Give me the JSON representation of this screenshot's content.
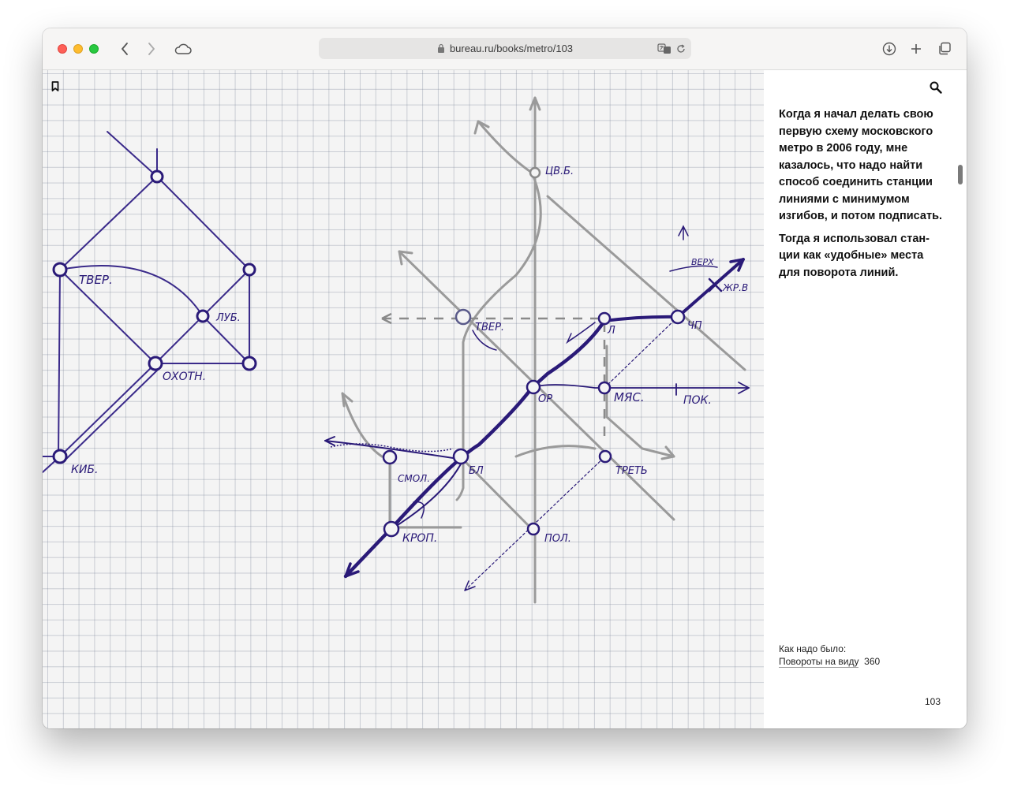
{
  "browser": {
    "url": "bureau.ru/books/metro/103",
    "icons": [
      "back-icon",
      "forward-icon",
      "cloud-icon",
      "lock-icon",
      "translate-icon",
      "reload-icon",
      "download-icon",
      "new-tab-icon",
      "tabs-overview-icon"
    ]
  },
  "sketch": {
    "labels": {
      "tver_left": "ТВЕР.",
      "lub": "ЛУБ.",
      "okhotn": "ОХОТН.",
      "kiev": "КИБ.",
      "tsvb": "ЦВ.Б.",
      "tver": "ТВЕР.",
      "verkh": "ВЕРХ",
      "zhr": "ЖР.В",
      "chp": "ЧП",
      "kitay_a": "Л",
      "op": "ОР",
      "myas": "МЯС.",
      "pok": "ПОК.",
      "smol": "СМОЛ.",
      "bl": "БЛ",
      "tret": "ТРЕТЬ",
      "krop": "КРОП.",
      "pol": "ПОЛ."
    }
  },
  "sidebar": {
    "paragraph1": "Когда я начал делать свою первую схему московского метро в 2006 году, мне казалось, что надо найти способ соединить станции линиями с минимумом изгибов, и потом подписать.",
    "paragraph2": "Тогда я использовал стан­ции как «удобные» места для поворота линий.",
    "xref_label": "Как надо было:",
    "xref_link": "Повороты на виду",
    "xref_page": "360",
    "page_number": "103"
  }
}
